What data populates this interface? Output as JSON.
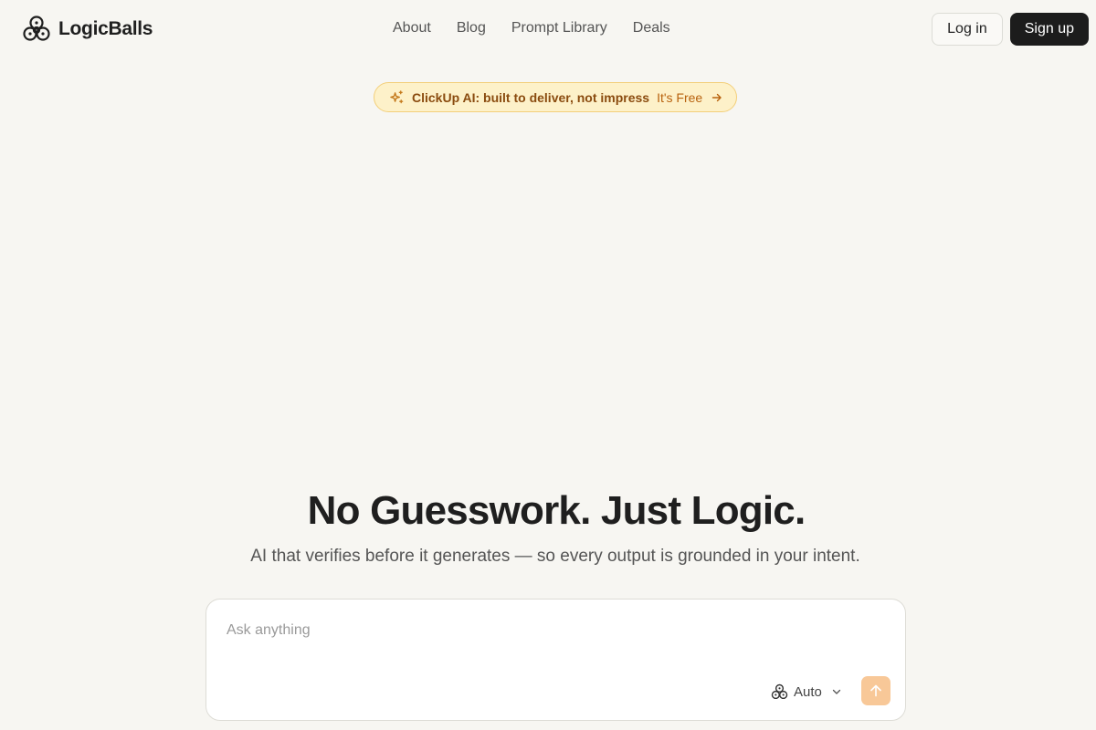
{
  "brand": {
    "name": "LogicBalls",
    "logo_icon": "logicballs-logo-icon"
  },
  "nav": {
    "items": [
      {
        "label": "About"
      },
      {
        "label": "Blog"
      },
      {
        "label": "Prompt Library"
      },
      {
        "label": "Deals"
      }
    ]
  },
  "auth": {
    "login_label": "Log in",
    "signup_label": "Sign up"
  },
  "promo": {
    "icon": "sparkle-icon",
    "text": "ClickUp AI: built to deliver, not impress",
    "cta": "It's Free",
    "arrow_icon": "arrow-right-icon",
    "colors": {
      "background": "#fdf1c9",
      "border": "#f3cf7a",
      "text": "#8a4b0f",
      "cta": "#b8620e"
    }
  },
  "hero": {
    "title": "No Guesswork. Just Logic.",
    "subtitle": "AI that verifies before it generates — so every output is grounded in your intent."
  },
  "chat": {
    "placeholder": "Ask anything",
    "value": "",
    "model": {
      "label": "Auto",
      "icon": "logicballs-logo-icon"
    },
    "send_icon": "arrow-up-icon",
    "send_color": "#f8c898"
  }
}
